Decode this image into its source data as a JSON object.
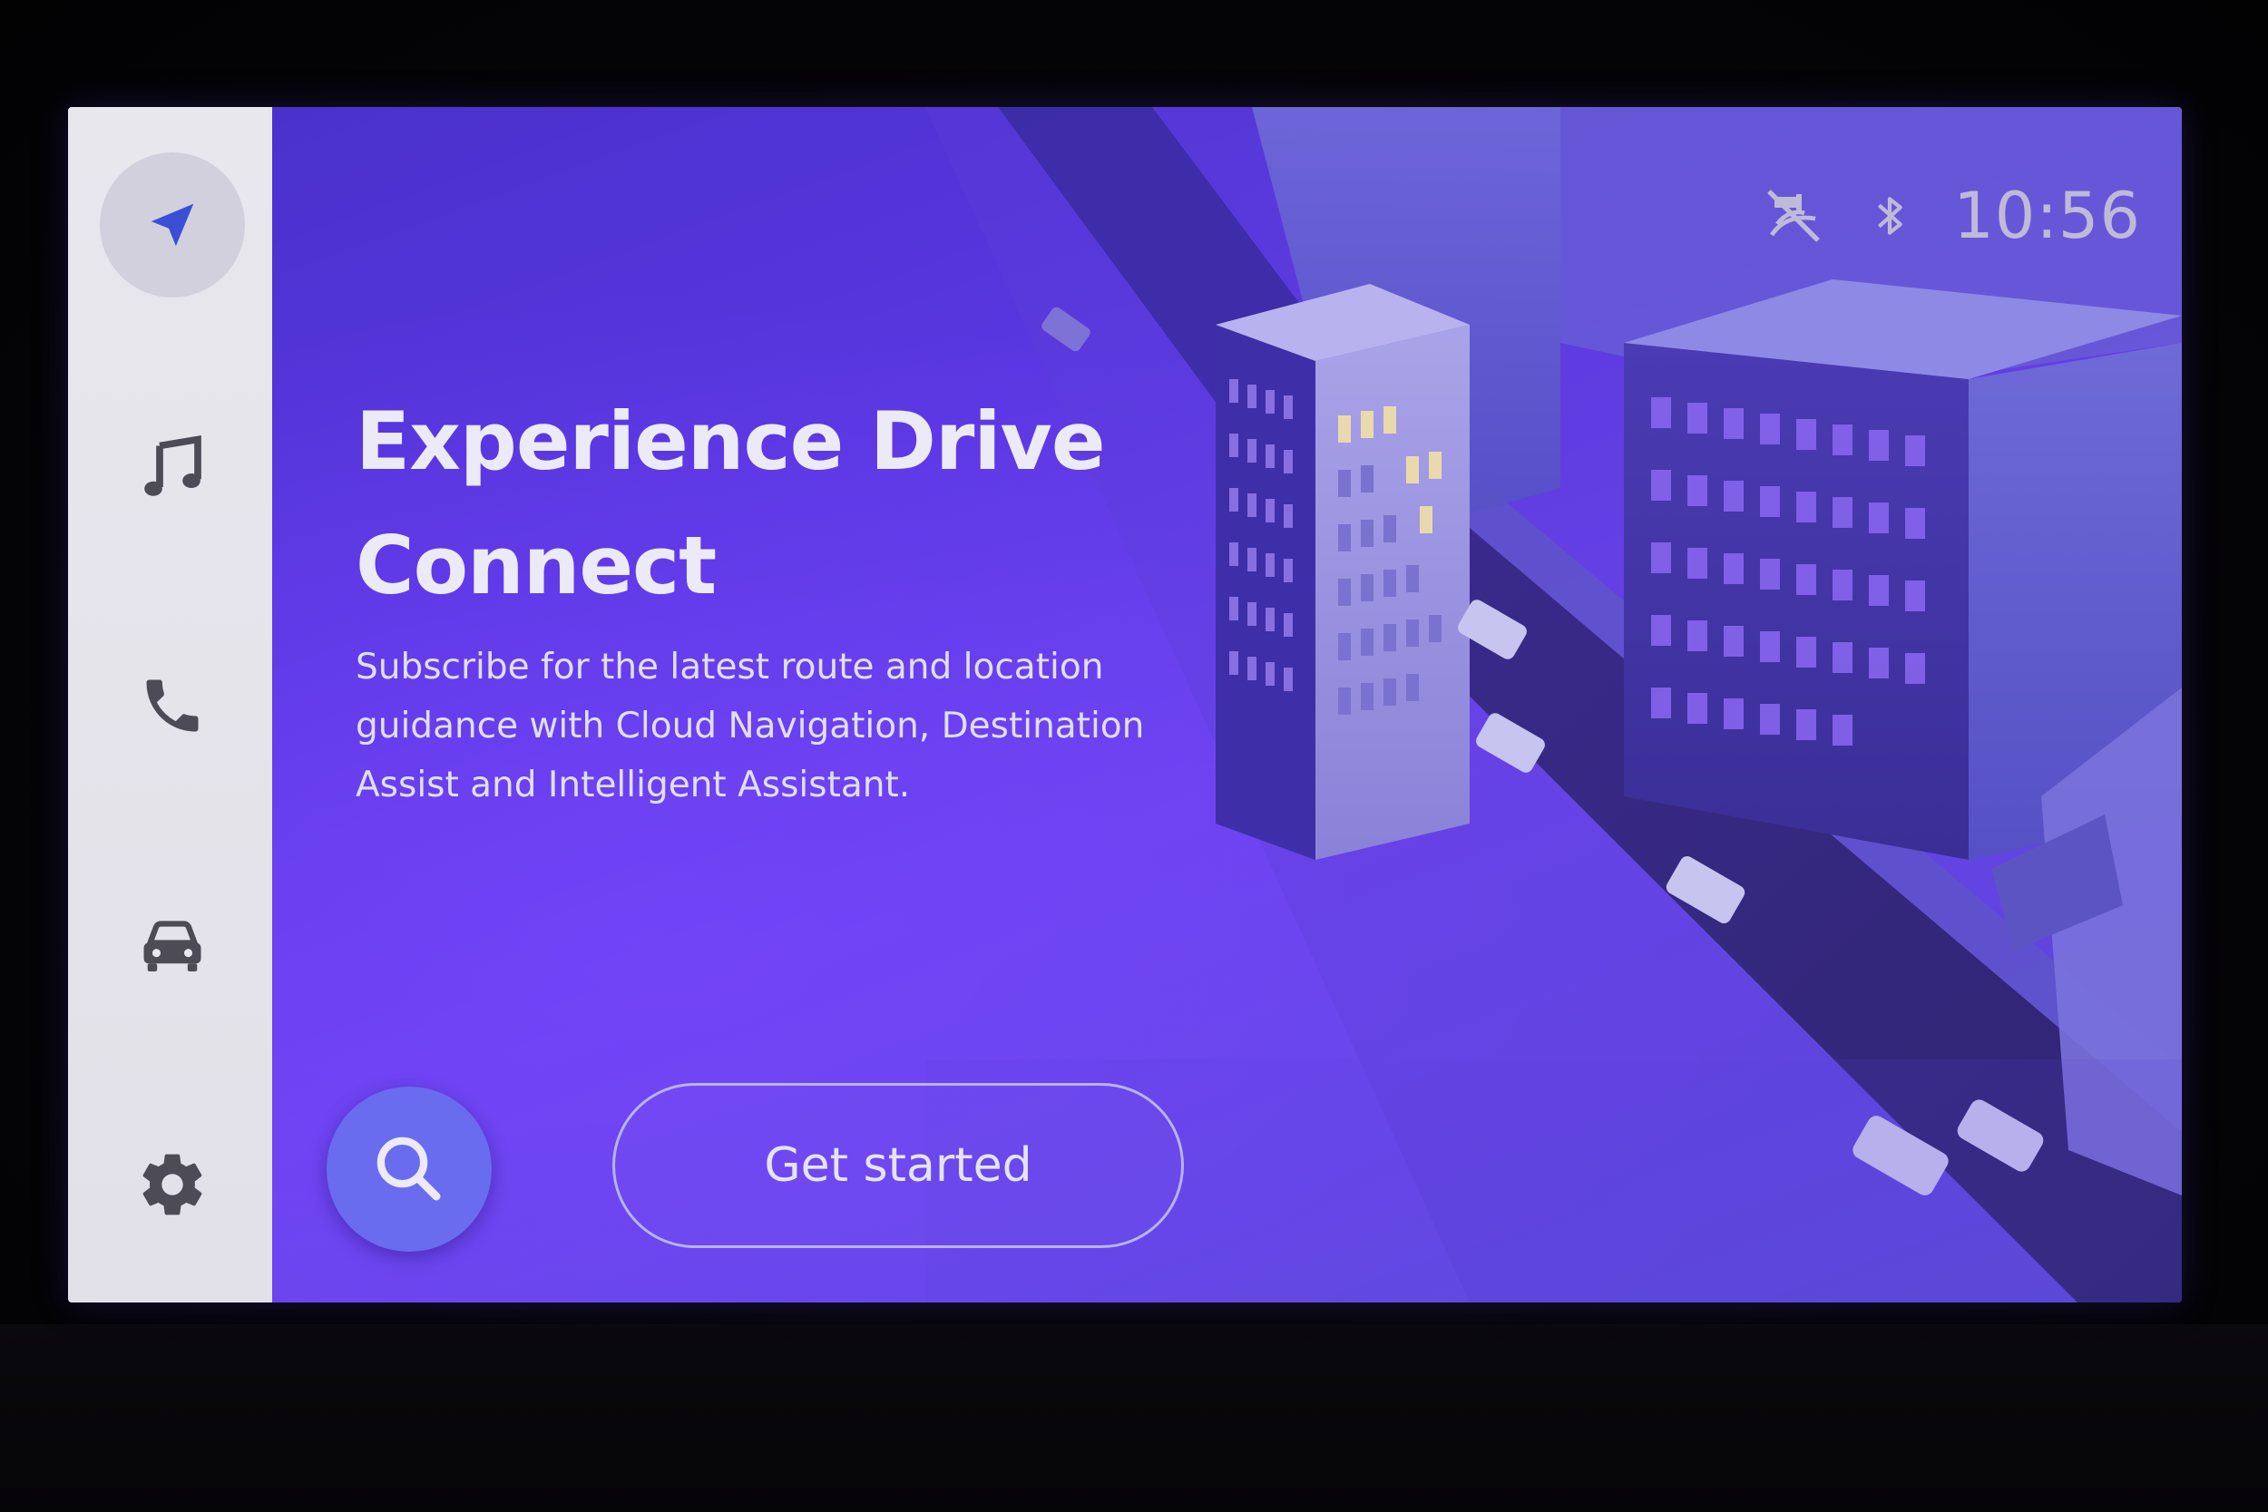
{
  "sidebar": {
    "items": [
      {
        "icon": "navigation-arrow-icon",
        "active": true
      },
      {
        "icon": "music-note-icon",
        "active": false
      },
      {
        "icon": "phone-icon",
        "active": false
      },
      {
        "icon": "car-icon",
        "active": false
      },
      {
        "icon": "gear-icon",
        "active": false
      }
    ]
  },
  "status": {
    "time": "10:56",
    "icons": [
      "no-location-signal-icon",
      "bluetooth-icon"
    ]
  },
  "hero": {
    "title": "Experience Drive Connect",
    "description": "Subscribe for the latest route and location guidance with Cloud Navigation, Destination Assist and Intelligent Assistant."
  },
  "actions": {
    "search_icon": "search-icon",
    "get_started_label": "Get started"
  },
  "colors": {
    "sidebar_bg": "#e9e7ee",
    "active_icon": "#3a4fd6",
    "icon_gray": "#4d4b56",
    "search_button": "#6a6cf0",
    "background_purple": "#5a37e2"
  }
}
